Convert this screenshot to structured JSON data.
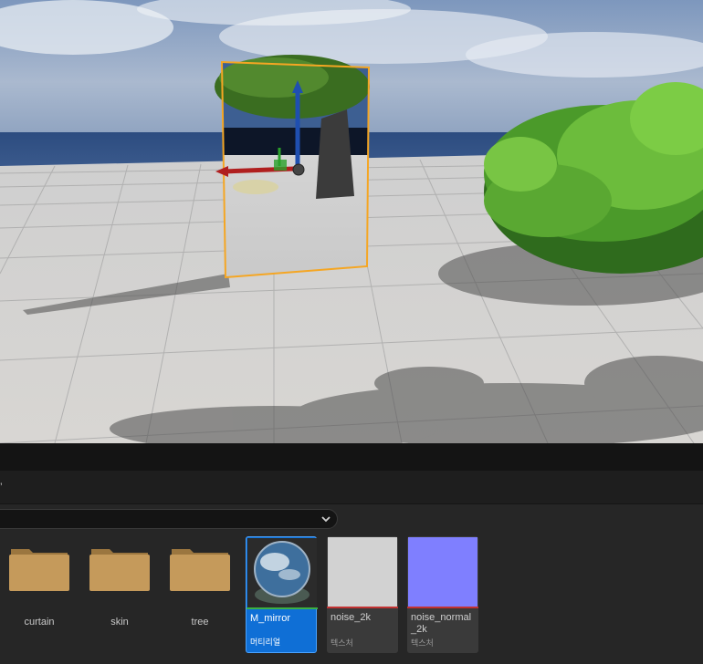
{
  "viewport": {
    "scene": "3d-level-viewport"
  },
  "content_browser": {
    "header_tick": "’",
    "folders": [
      {
        "label": ""
      },
      {
        "label": "curtain"
      },
      {
        "label": "skin"
      },
      {
        "label": "tree"
      }
    ],
    "assets": [
      {
        "name": "M_mirror",
        "type": "머티리얼",
        "bar_color": "#3cb043"
      },
      {
        "name": "noise_2k",
        "type": "텍스처",
        "bar_color": "#c23232"
      },
      {
        "name": "noise_normal_2k",
        "type": "텍스처",
        "bar_color": "#c23232"
      }
    ]
  },
  "colors": {
    "selection": "#f5a623",
    "selected_tile": "#0f6fd6",
    "folder": "#c59a5b"
  }
}
